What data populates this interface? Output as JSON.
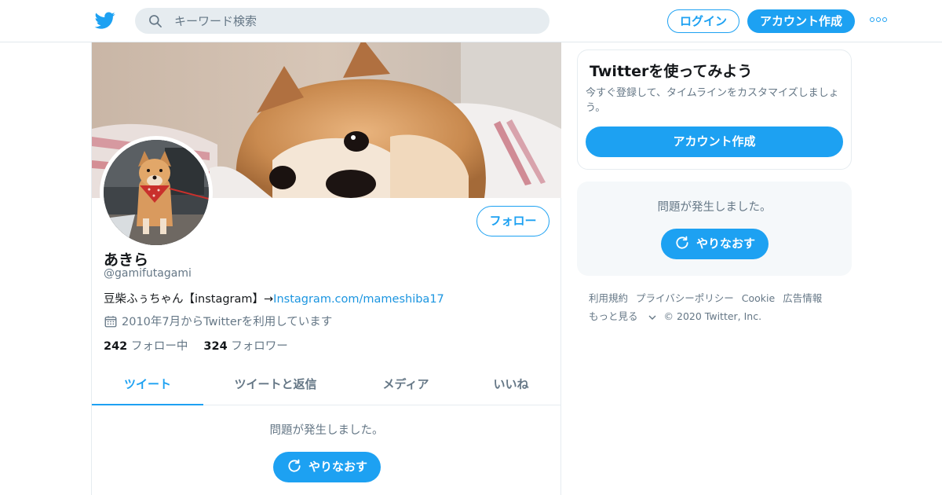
{
  "header": {
    "search_placeholder": "キーワード検索",
    "login_label": "ログイン",
    "signup_label": "アカウント作成",
    "brand_color": "#1da1f2"
  },
  "profile": {
    "name": "あきら",
    "handle": "@gamifutagami",
    "bio_text": "豆柴ふぅちゃん【instagram】→",
    "bio_link": "Instagram.com/mameshiba17",
    "joined": "2010年7月からTwitterを利用しています",
    "following_count": "242",
    "following_label": "フォロー中",
    "followers_count": "324",
    "followers_label": "フォロワー",
    "follow_button": "フォロー"
  },
  "tabs": [
    {
      "label": "ツイート",
      "active": true
    },
    {
      "label": "ツイートと返信",
      "active": false
    },
    {
      "label": "メディア",
      "active": false
    },
    {
      "label": "いいね",
      "active": false
    }
  ],
  "timeline": {
    "error_message": "問題が発生しました。",
    "retry_label": "やりなおす"
  },
  "sidebar": {
    "join_title": "Twitterを使ってみよう",
    "join_desc": "今すぐ登録して、タイムラインをカスタマイズしましょう。",
    "join_button": "アカウント作成",
    "error_message": "問題が発生しました。",
    "retry_label": "やりなおす"
  },
  "footer": {
    "links": [
      "利用規約",
      "プライバシーポリシー",
      "Cookie",
      "広告情報"
    ],
    "more_label": "もっと見る",
    "copyright": "© 2020 Twitter, Inc."
  }
}
